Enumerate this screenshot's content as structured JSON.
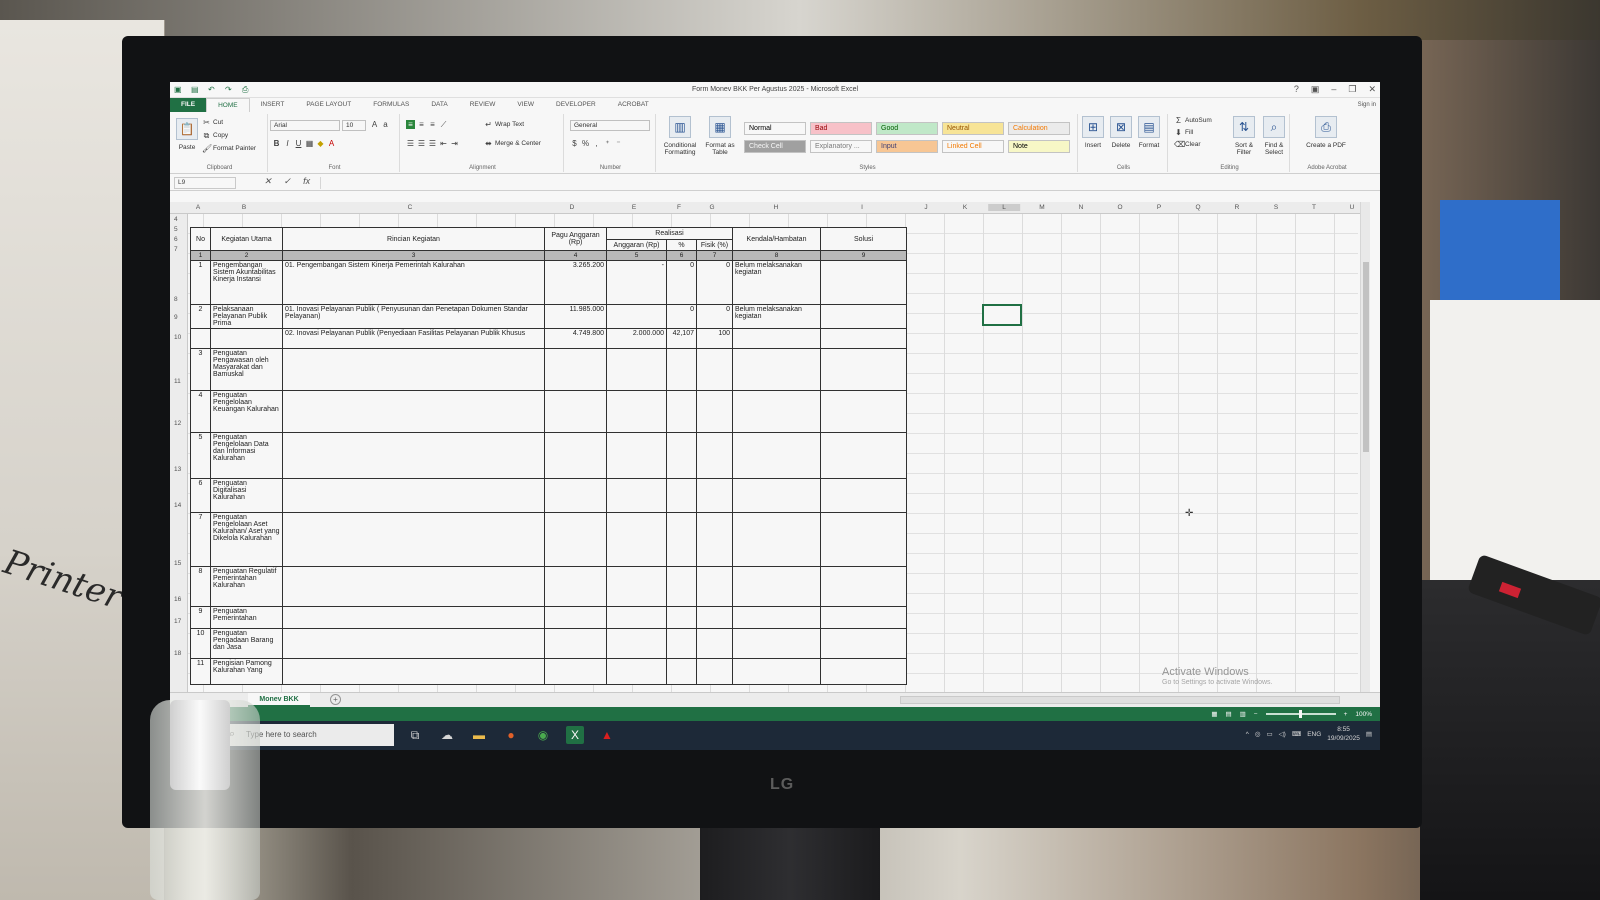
{
  "excel": {
    "title": "Form Monev BKK Per Agustus 2025 - Microsoft Excel",
    "tabs": [
      "FILE",
      "HOME",
      "INSERT",
      "PAGE LAYOUT",
      "FORMULAS",
      "DATA",
      "REVIEW",
      "VIEW",
      "DEVELOPER",
      "ACROBAT"
    ],
    "sign_in": "Sign in",
    "ribbon": {
      "clipboard": {
        "label": "Clipboard",
        "paste": "Paste",
        "cut": "Cut",
        "copy": "Copy",
        "format_painter": "Format Painter"
      },
      "font": {
        "label": "Font",
        "name": "Arial",
        "size": "10"
      },
      "alignment": {
        "label": "Alignment",
        "wrap": "Wrap Text",
        "merge": "Merge & Center"
      },
      "number": {
        "label": "Number",
        "format": "General"
      },
      "styles": {
        "label": "Styles",
        "conditional": "Conditional Formatting",
        "format_table": "Format as Table",
        "cells": [
          {
            "name": "Normal",
            "bg": "#ffffff",
            "fg": "#000000"
          },
          {
            "name": "Bad",
            "bg": "#ffc7ce",
            "fg": "#9c0006"
          },
          {
            "name": "Good",
            "bg": "#c6efce",
            "fg": "#006100"
          },
          {
            "name": "Neutral",
            "bg": "#ffeb9c",
            "fg": "#9c5700"
          },
          {
            "name": "Calculation",
            "bg": "#f2f2f2",
            "fg": "#fa7d00"
          },
          {
            "name": "Check Cell",
            "bg": "#a5a5a5",
            "fg": "#ffffff"
          },
          {
            "name": "Explanatory ...",
            "bg": "#ffffff",
            "fg": "#7f7f7f"
          },
          {
            "name": "Input",
            "bg": "#ffcc99",
            "fg": "#3f3f76"
          },
          {
            "name": "Linked Cell",
            "bg": "#ffffff",
            "fg": "#fa7d00"
          },
          {
            "name": "Note",
            "bg": "#ffffcc",
            "fg": "#000000"
          }
        ]
      },
      "cells": {
        "label": "Cells",
        "insert": "Insert",
        "delete": "Delete",
        "format": "Format"
      },
      "editing": {
        "label": "Editing",
        "autosum": "AutoSum",
        "fill": "Fill",
        "clear": "Clear",
        "sort": "Sort & Filter",
        "find": "Find & Select"
      },
      "acrobat": {
        "label": "Adobe Acrobat",
        "create": "Create a PDF"
      }
    },
    "namebox": "L9",
    "fx": "fx",
    "columns": [
      "A",
      "B",
      "C",
      "D",
      "E",
      "F",
      "G",
      "H",
      "I",
      "J",
      "K",
      "L",
      "M",
      "N",
      "O",
      "P",
      "Q",
      "R",
      "S",
      "T",
      "U"
    ],
    "rows": [
      "4",
      "5",
      "6",
      "7",
      "8",
      "9",
      "10",
      "11",
      "12",
      "13",
      "14",
      "15",
      "16",
      "17",
      "18"
    ],
    "sheet_tab": "Monev BKK",
    "watermark_title": "Activate Windows",
    "watermark_sub": "Go to Settings to activate Windows.",
    "zoom": "100%"
  },
  "table": {
    "headers": {
      "no": "No",
      "kegiatan": "Kegiatan Utama",
      "rincian": "Rincian Kegiatan",
      "pagu": "Pagu Anggaran (Rp)",
      "realisasi": "Realisasi",
      "anggaran": "Anggaran (Rp)",
      "persen": "%",
      "fisik": "Fisik (%)",
      "kendala": "Kendala/Hambatan",
      "solusi": "Solusi"
    },
    "col_numbers": [
      "1",
      "2",
      "3",
      "4",
      "5",
      "6",
      "7",
      "8",
      "9"
    ],
    "rows": [
      {
        "no": "1",
        "kegiatan": "Pengembangan Sistem Akuntabilitas Kinerja Instansi",
        "rincian": "01. Pengembangan Sistem Kinerja Pemerintah Kalurahan",
        "pagu": "3.265.200",
        "anggaran": "-",
        "persen": "0",
        "fisik": "0",
        "kendala": "Belum melaksanakan kegiatan",
        "solusi": ""
      },
      {
        "no": "2",
        "kegiatan": "Pelaksanaan Pelayanan Publik Prima",
        "rincian": "01. Inovasi Pelayanan Publik ( Penyusunan dan Penetapan Dokumen Standar Pelayanan)",
        "pagu": "11.985.000",
        "anggaran": "",
        "persen": "0",
        "fisik": "0",
        "kendala": "Belum melaksanakan kegiatan",
        "solusi": ""
      },
      {
        "no": "",
        "kegiatan": "",
        "rincian": "02. Inovasi Pelayanan Publik (Penyediaan Fasilitas Pelayanan Publik Khusus",
        "pagu": "4.749.800",
        "anggaran": "2.000.000",
        "persen": "42,107",
        "fisik": "100",
        "kendala": "",
        "solusi": ""
      },
      {
        "no": "3",
        "kegiatan": "Penguatan Pengawasan oleh Masyarakat dan Bamuskal",
        "rincian": "",
        "pagu": "",
        "anggaran": "",
        "persen": "",
        "fisik": "",
        "kendala": "",
        "solusi": ""
      },
      {
        "no": "4",
        "kegiatan": "Penguatan Pengelolaan Keuangan Kalurahan",
        "rincian": "",
        "pagu": "",
        "anggaran": "",
        "persen": "",
        "fisik": "",
        "kendala": "",
        "solusi": ""
      },
      {
        "no": "5",
        "kegiatan": "Penguatan Pengelolaan Data dan Informasi Kalurahan",
        "rincian": "",
        "pagu": "",
        "anggaran": "",
        "persen": "",
        "fisik": "",
        "kendala": "",
        "solusi": ""
      },
      {
        "no": "6",
        "kegiatan": "Penguatan Digitalisasi Kalurahan",
        "rincian": "",
        "pagu": "",
        "anggaran": "",
        "persen": "",
        "fisik": "",
        "kendala": "",
        "solusi": ""
      },
      {
        "no": "7",
        "kegiatan": "Penguatan Pengelolaan Aset Kalurahan/ Aset yang Dikelola Kalurahan",
        "rincian": "",
        "pagu": "",
        "anggaran": "",
        "persen": "",
        "fisik": "",
        "kendala": "",
        "solusi": ""
      },
      {
        "no": "8",
        "kegiatan": "Penguatan Regulatif Pemerintahan Kalurahan",
        "rincian": "",
        "pagu": "",
        "anggaran": "",
        "persen": "",
        "fisik": "",
        "kendala": "",
        "solusi": ""
      },
      {
        "no": "9",
        "kegiatan": "Penguatan Pemerintahan",
        "rincian": "",
        "pagu": "",
        "anggaran": "",
        "persen": "",
        "fisik": "",
        "kendala": "",
        "solusi": ""
      },
      {
        "no": "10",
        "kegiatan": "Penguatan Pengadaan Barang dan Jasa",
        "rincian": "",
        "pagu": "",
        "anggaran": "",
        "persen": "",
        "fisik": "",
        "kendala": "",
        "solusi": ""
      },
      {
        "no": "11",
        "kegiatan": "Pengisian Pamong Kalurahan Yang",
        "rincian": "",
        "pagu": "",
        "anggaran": "",
        "persen": "",
        "fisik": "",
        "kendala": "",
        "solusi": ""
      }
    ]
  },
  "taskbar": {
    "search_placeholder": "Type here to search",
    "lang": "ENG",
    "time": "8:55",
    "date": "19/09/2025"
  },
  "monitor_brand": "LG",
  "handwriting": "Printer"
}
